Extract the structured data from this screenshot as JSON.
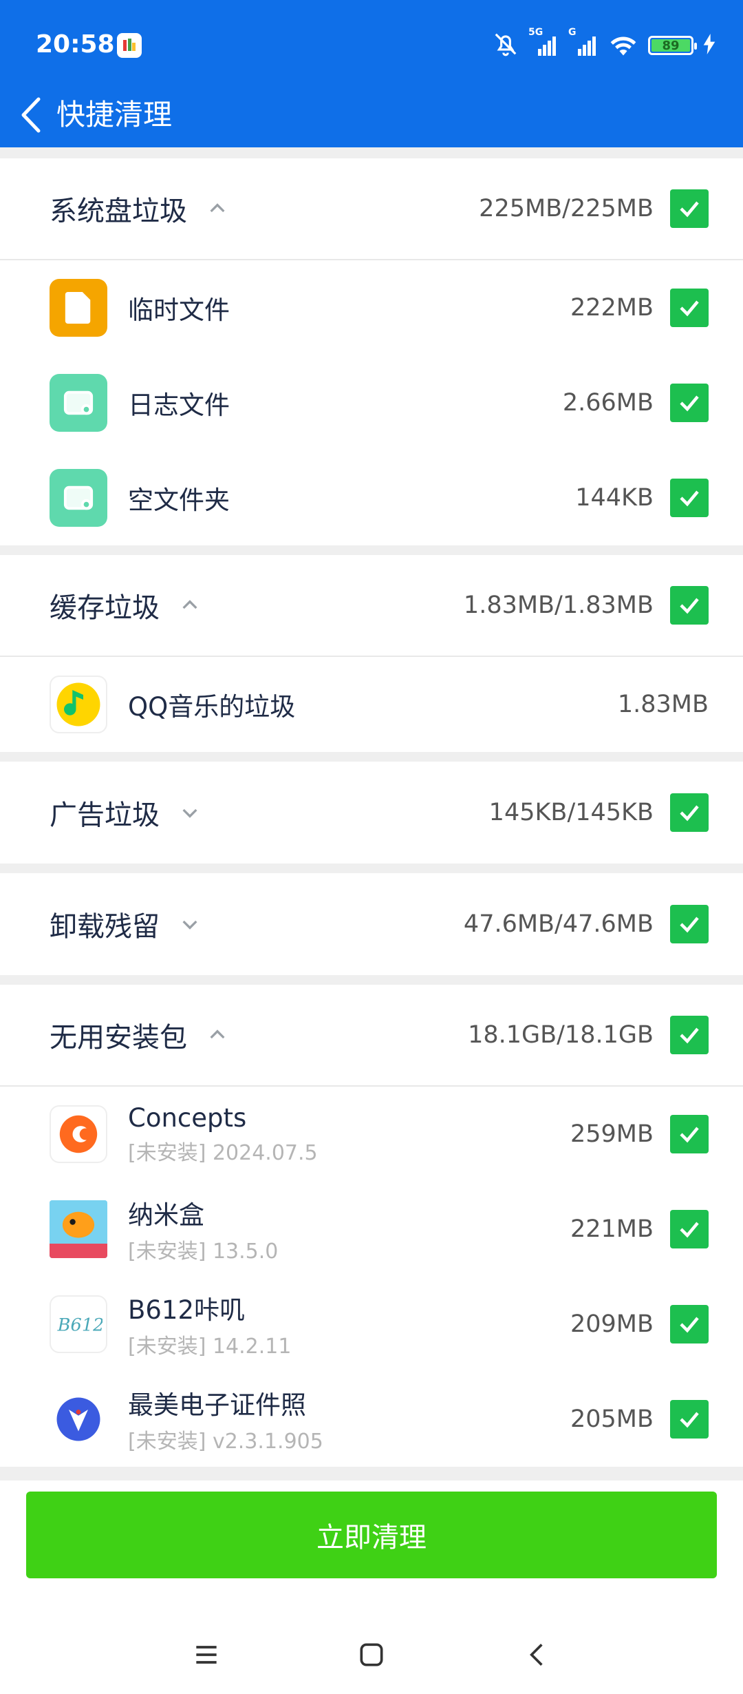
{
  "status_bar": {
    "time": "20:58",
    "battery": "89",
    "network_1": "5G",
    "network_2": "G"
  },
  "header": {
    "title": "快捷清理",
    "back_icon": "chevron-left-icon"
  },
  "groups": [
    {
      "title": "系统盘垃圾",
      "expanded": true,
      "size": "225MB/225MB",
      "checked": true,
      "items": [
        {
          "name": "临时文件",
          "size": "222MB",
          "icon": "file-icon",
          "color": "#f5a500",
          "checked": true
        },
        {
          "name": "日志文件",
          "size": "2.66MB",
          "icon": "folder-icon",
          "color": "#5fd9ad",
          "checked": true
        },
        {
          "name": "空文件夹",
          "size": "144KB",
          "icon": "folder-icon",
          "color": "#5fd9ad",
          "checked": true
        }
      ]
    },
    {
      "title": "缓存垃圾",
      "expanded": true,
      "size": "1.83MB/1.83MB",
      "checked": true,
      "items": [
        {
          "name": "QQ音乐的垃圾",
          "size": "1.83MB",
          "icon": "qq-music-icon",
          "color": "#ffd500"
        }
      ]
    },
    {
      "title": "广告垃圾",
      "expanded": false,
      "size": "145KB/145KB",
      "checked": true
    },
    {
      "title": "卸载残留",
      "expanded": false,
      "size": "47.6MB/47.6MB",
      "checked": true
    },
    {
      "title": "无用安装包",
      "expanded": true,
      "size": "18.1GB/18.1GB",
      "checked": true,
      "items": [
        {
          "name": "Concepts",
          "sub": "[未安装] 2024.07.5",
          "size": "259MB",
          "icon": "concepts-app-icon",
          "checked": true
        },
        {
          "name": "纳米盒",
          "sub": "[未安装] 13.5.0",
          "size": "221MB",
          "icon": "nanohe-app-icon",
          "checked": true
        },
        {
          "name": "B612咔叽",
          "sub": "[未安装] 14.2.11",
          "size": "209MB",
          "icon": "b612-app-icon",
          "checked": true
        },
        {
          "name": "最美电子证件照",
          "sub": "[未安装] v2.3.1.905",
          "size": "205MB",
          "icon": "id-photo-app-icon",
          "checked": true
        }
      ]
    }
  ],
  "action": {
    "clean_label": "立即清理"
  },
  "colors": {
    "header_bg": "#0f6fe8",
    "check_green": "#1dbf4f",
    "button_green": "#3fd115"
  }
}
